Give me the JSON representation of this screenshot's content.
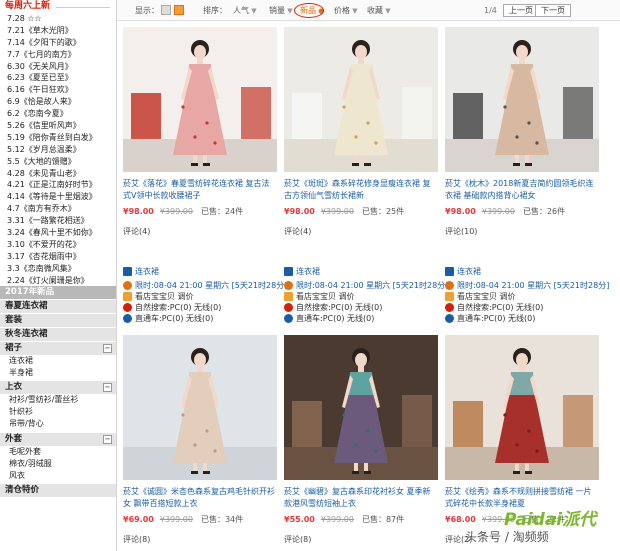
{
  "sidebar": {
    "section1_title": "每周六上新",
    "new_items": [
      "7.28 ☆☆",
      "7.21《草木光阴》",
      "7.14《夕阳下的歌》",
      "7.7《七月的南方》",
      "6.30《无关风月》",
      "6.23《夏至已至》",
      "6.16《午日狂欢》",
      "6.9《恰是故人来》",
      "6.2《恋南今夏》",
      "5.26《信里听风声》",
      "5.19《陪你青丝到白发》",
      "5.12《岁月总温柔》",
      "5.5《大地的馈赠》",
      "4.28《未见青山老》",
      "4.21《正是江南好时节》",
      "4.14《等待是十里烟波》",
      "4.7《南方有乔木》",
      "3.31《一路繁花相送》",
      "3.24《春风十里不如你》",
      "3.10《不爱开的花》",
      "3.17《杏花烟雨中》",
      "3.3《恋南微风集》",
      "2.24《灯火阑珊是你》"
    ],
    "section2_title": "2017年新品",
    "spring": "春夏连衣裙",
    "suits": "套装",
    "autumn": "秋冬连衣裙",
    "skirts_title": "裙子",
    "skirts_items": [
      "连衣裙",
      "半身裙"
    ],
    "tops_title": "上衣",
    "tops_items": [
      "衬衫/雪纺衫/蕾丝衫",
      "针织衫",
      "吊带/背心"
    ],
    "outer_title": "外套",
    "outer_items": [
      "毛呢外套",
      "棉衣/羽绒服",
      "风衣"
    ],
    "discount_title": "清仓特价"
  },
  "toolbar": {
    "display_label": "显示：",
    "sort_label": "排序：",
    "popularity": "人气",
    "sales": "销量",
    "new": "新品",
    "price": "价格",
    "favorites": "收藏",
    "page_indicator": "1/4",
    "prev_page": "上一页",
    "next_page": "下一页"
  },
  "products": [
    {
      "title": "菸艾《落花》春夏雪纺碎花连衣裙 复古法式V领中长款收腰裙子",
      "price": "¥98.00",
      "old_price": "¥399.00",
      "sold": "已售：24件",
      "reviews": "评论(4)",
      "image": "pink floral dress"
    },
    {
      "title": "菸艾《斑斑》森系碎花修身显瘦连衣裙 复古方领仙气雪纺长裙新",
      "price": "¥98.00",
      "old_price": "¥399.00",
      "sold": "已售：25件",
      "reviews": "评论(4)",
      "image": "beige floral dress"
    },
    {
      "title": "菸艾《枕木》2018新夏吉简约圆领毛织连衣裙 基础款内搭背心裙女",
      "price": "¥98.00",
      "old_price": "¥399.00",
      "sold": "已售：26件",
      "reviews": "评论(10)",
      "image": "tan knit dress"
    },
    {
      "title": "菸艾《诚圆》米杏色森系复古鸡毛针织开衫女 飘带百搭短款上衣",
      "price": "¥69.00",
      "old_price": "¥399.00",
      "sold": "已售：34件",
      "reviews": "评论(8)",
      "image": "beige cardigan"
    },
    {
      "title": "菸艾《幽碧》复古森系印花衬衫女 夏季新款港风雪纺短袖上衣",
      "price": "¥55.00",
      "old_price": "¥399.00",
      "sold": "已售：87件",
      "reviews": "评论(8)",
      "image": "teal print shirt"
    },
    {
      "title": "菸艾《绘秀》森系不规则拼接雪纺裙 一片式碎花中长款半身裙夏",
      "price": "¥68.00",
      "old_price": "¥399.00",
      "sold": "已售：22件",
      "reviews": "评论(2)",
      "image": "red floral skirt"
    }
  ],
  "promos": [
    {
      "tag": "连衣裙",
      "timer": "限时:08-04 21:00 星期六 [5天21时28分]",
      "shop": "看店宝宝贝 调价",
      "search": "自然搜索:PC(0) 无线(0)",
      "cart": "直通车:PC(0) 无线(0)"
    },
    {
      "tag": "连衣裙",
      "timer": "限时:08-04 21:00 星期六 [5天21时28分]",
      "shop": "看店宝宝贝 调价",
      "search": "自然搜索:PC(0) 无线(0)",
      "cart": "直通车:PC(0) 无线(0)"
    },
    {
      "tag": "连衣裙",
      "timer": "限时:08-04 21:00 星期六 [5天21时28分]",
      "shop": "看店宝宝贝 调价",
      "search": "自然搜索:PC(0) 无线(0)",
      "cart": "直通车:PC(0) 无线(0)"
    }
  ],
  "watermark": {
    "brand": "Paidai派代",
    "source": "头条号 / 淘频频"
  },
  "colors": {
    "accent_red": "#e4393c",
    "link_blue": "#1a5ca8",
    "circle_red": "#d81e06",
    "sidebar_header": "#b8b8b8"
  }
}
